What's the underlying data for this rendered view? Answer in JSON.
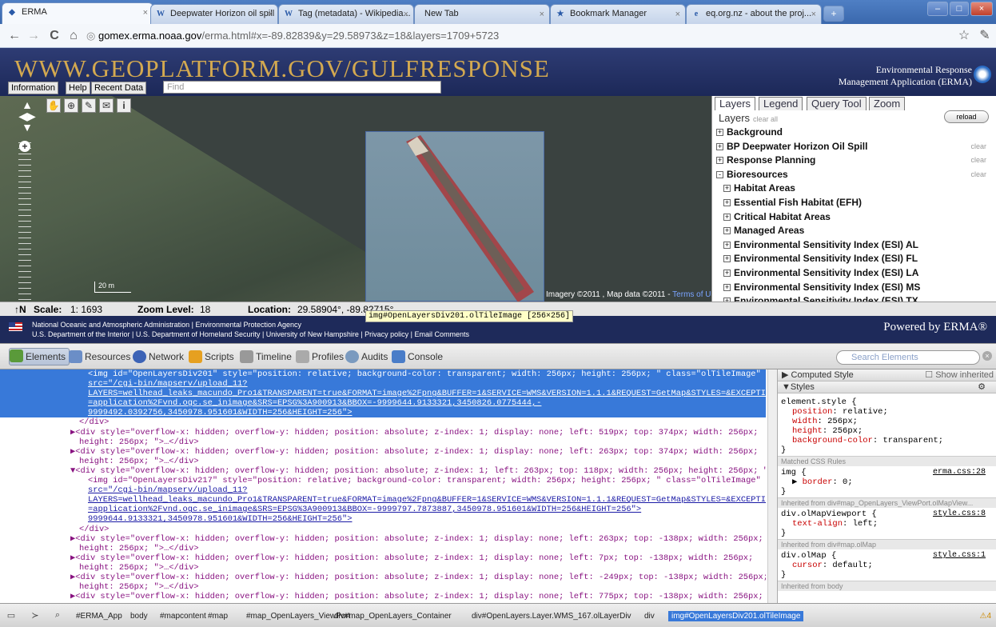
{
  "browser": {
    "tabs": [
      {
        "label": "ERMA",
        "fav": "e"
      },
      {
        "label": "Deepwater Horizon oil spill ...",
        "fav": "W"
      },
      {
        "label": "Tag (metadata) - Wikipedia...",
        "fav": "W"
      },
      {
        "label": "New Tab",
        "fav": ""
      },
      {
        "label": "Bookmark Manager",
        "fav": "★"
      },
      {
        "label": "eq.org.nz - about the proj...",
        "fav": "e"
      }
    ],
    "url_host": "gomex.erma.noaa.gov",
    "url_rest": "/erma.html#x=-89.82839&y=29.58973&z=18&layers=1709+5723"
  },
  "header": {
    "title": "WWW.GEOPLATFORM.GOV/GULFRESPONSE",
    "erma_line1": "Environmental Response",
    "erma_line2": "Management Application (ERMA)",
    "btn_information": "Information",
    "btn_help": "Help",
    "btn_recent": "Recent Data",
    "find_placeholder": "Find"
  },
  "map": {
    "scale_label": "20 m",
    "attribution": "Imagery ©2011 , Map data ©2011 - ",
    "terms": "Terms of Use"
  },
  "panel": {
    "tabs": [
      "Layers",
      "Legend",
      "Query Tool",
      "Zoom"
    ],
    "reload": "reload",
    "layers_title": "Layers",
    "clear_all": "clear all",
    "clear": "clear",
    "rows": [
      {
        "sym": "+",
        "label": "Background",
        "clear": false,
        "sub": false
      },
      {
        "sym": "+",
        "label": "BP Deepwater Horizon Oil Spill",
        "clear": true,
        "sub": false
      },
      {
        "sym": "+",
        "label": "Response Planning",
        "clear": true,
        "sub": false
      },
      {
        "sym": "-",
        "label": "Bioresources",
        "clear": true,
        "sub": false
      },
      {
        "sym": "+",
        "label": "Habitat Areas",
        "clear": false,
        "sub": true
      },
      {
        "sym": "+",
        "label": "Essential Fish Habitat (EFH)",
        "clear": false,
        "sub": true
      },
      {
        "sym": "+",
        "label": "Critical Habitat Areas",
        "clear": false,
        "sub": true
      },
      {
        "sym": "+",
        "label": "Managed Areas",
        "clear": false,
        "sub": true
      },
      {
        "sym": "+",
        "label": "Environmental Sensitivity Index (ESI) AL",
        "clear": false,
        "sub": true
      },
      {
        "sym": "+",
        "label": "Environmental Sensitivity Index (ESI) FL",
        "clear": false,
        "sub": true
      },
      {
        "sym": "+",
        "label": "Environmental Sensitivity Index (ESI) LA",
        "clear": false,
        "sub": true
      },
      {
        "sym": "+",
        "label": "Environmental Sensitivity Index (ESI) MS",
        "clear": false,
        "sub": true
      },
      {
        "sym": "+",
        "label": "Environmental Sensitivity Index (ESI) TX",
        "clear": false,
        "sub": true
      }
    ]
  },
  "status": {
    "north": "↑N",
    "scale_label": "Scale:",
    "scale_value": "1: 1693",
    "zoom_label": "Zoom Level:",
    "zoom_value": "18",
    "location_label": "Location:",
    "location_value": "29.58904°, -89.82715°",
    "tooltip": "img#OpenLayersDiv201.olTileImage [256×256]"
  },
  "footer": {
    "line1": "National Oceanic and Atmospheric Administration | Environmental Protection Agency",
    "line2": "U.S. Department of the Interior | U.S. Department of Homeland Security | University of New Hampshire | Privacy policy | Email Comments",
    "powered": "Powered by ERMA®"
  },
  "devtools": {
    "tabs": [
      "Elements",
      "Resources",
      "Network",
      "Scripts",
      "Timeline",
      "Profiles",
      "Audits",
      "Console"
    ],
    "search_placeholder": "Search Elements",
    "dom_lines": [
      {
        "t": "<img id=\"OpenLayersDiv201\" style=\"position: relative; background-color: transparent; width: 256px; height: 256px; \" class=\"olTileImage\"",
        "sel": true,
        "ind": 2
      },
      {
        "t": "src=\"/cgi-bin/mapserv/upload_11?",
        "sel": true,
        "ind": 2,
        "link": true
      },
      {
        "t": "LAYERS=wellhead_leaks_macundo_Pro1&TRANSPARENT=true&FORMAT=image%2Fpng&BUFFER=1&SERVICE=WMS&VERSION=1.1.1&REQUEST=GetMap&STYLES=&EXCEPTIONS",
        "sel": true,
        "ind": 2,
        "link": true
      },
      {
        "t": "=application%2Fvnd.ogc.se_inimage&SRS=EPSG%3A900913&BBOX=-9999644.9133321,3450826.0775444,-",
        "sel": true,
        "ind": 2,
        "link": true
      },
      {
        "t": "9999492.0392756,3450978.951601&WIDTH=256&HEIGHT=256\">",
        "sel": true,
        "ind": 2,
        "link": true
      },
      {
        "t": "</div>",
        "sel": false,
        "ind": 1
      },
      {
        "t": "▶<div style=\"overflow-x: hidden; overflow-y: hidden; position: absolute; z-index: 1; display: none; left: 519px; top: 374px; width: 256px;",
        "sel": false,
        "ind": 0
      },
      {
        "t": "height: 256px; \">…</div>",
        "sel": false,
        "ind": 1
      },
      {
        "t": "▶<div style=\"overflow-x: hidden; overflow-y: hidden; position: absolute; z-index: 1; display: none; left: 263px; top: 374px; width: 256px;",
        "sel": false,
        "ind": 0
      },
      {
        "t": "height: 256px; \">…</div>",
        "sel": false,
        "ind": 1
      },
      {
        "t": "▼<div style=\"overflow-x: hidden; overflow-y: hidden; position: absolute; z-index: 1; left: 263px; top: 118px; width: 256px; height: 256px; \">",
        "sel": false,
        "ind": 0
      },
      {
        "t": "<img id=\"OpenLayersDiv217\" style=\"position: relative; background-color: transparent; width: 256px; height: 256px; \" class=\"olTileImage\"",
        "sel": false,
        "ind": 2
      },
      {
        "t": "src=\"/cgi-bin/mapserv/upload_11?",
        "sel": false,
        "ind": 2,
        "link": true
      },
      {
        "t": "LAYERS=wellhead_leaks_macundo_Pro1&TRANSPARENT=true&FORMAT=image%2Fpng&BUFFER=1&SERVICE=WMS&VERSION=1.1.1&REQUEST=GetMap&STYLES=&EXCEPTIONS",
        "sel": false,
        "ind": 2,
        "link": true
      },
      {
        "t": "=application%2Fvnd.ogc.se_inimage&SRS=EPSG%3A900913&BBOX=-9999797.7873887,3450978.951601&WIDTH=256&HEIGHT=256\">",
        "sel": false,
        "ind": 2,
        "link": true
      },
      {
        "t": "9999644.9133321,3450978.951601&WIDTH=256&HEIGHT=256\">",
        "sel": false,
        "ind": 2,
        "link": true
      },
      {
        "t": "</div>",
        "sel": false,
        "ind": 1
      },
      {
        "t": "▶<div style=\"overflow-x: hidden; overflow-y: hidden; position: absolute; z-index: 1; display: none; left: 263px; top: -138px; width: 256px;",
        "sel": false,
        "ind": 0
      },
      {
        "t": "height: 256px; \">…</div>",
        "sel": false,
        "ind": 1
      },
      {
        "t": "▶<div style=\"overflow-x: hidden; overflow-y: hidden; position: absolute; z-index: 1; display: none; left: 7px; top: -138px; width: 256px;",
        "sel": false,
        "ind": 0
      },
      {
        "t": "height: 256px; \">…</div>",
        "sel": false,
        "ind": 1
      },
      {
        "t": "▶<div style=\"overflow-x: hidden; overflow-y: hidden; position: absolute; z-index: 1; display: none; left: -249px; top: -138px; width: 256px;",
        "sel": false,
        "ind": 0
      },
      {
        "t": "height: 256px; \">…</div>",
        "sel": false,
        "ind": 1
      },
      {
        "t": "▶<div style=\"overflow-x: hidden; overflow-y: hidden; position: absolute; z-index: 1; display: none; left: 775px; top: -138px; width: 256px;",
        "sel": false,
        "ind": 0
      }
    ],
    "styles": {
      "computed": "Computed Style",
      "show_inherited": "Show inherited",
      "styles_hdr": "Styles",
      "element_style": "element.style {",
      "es_props": [
        {
          "n": "position",
          "v": "relative;"
        },
        {
          "n": "width",
          "v": "256px;"
        },
        {
          "n": "height",
          "v": "256px;"
        },
        {
          "n": "background-color",
          "v": "transparent;"
        }
      ],
      "close": "}",
      "matched": "Matched CSS Rules",
      "img_rule": "img {",
      "img_src": "erma.css:28",
      "img_prop_n": "border",
      "img_prop_v": "0;",
      "inh1": "Inherited from div#map_OpenLayers_ViewPort.olMapView...",
      "vp_rule": "div.olMapViewport {",
      "vp_src": "style.css:8",
      "vp_prop_n": "text-align",
      "vp_prop_v": "left;",
      "inh2": "Inherited from div#map.olMap",
      "map_rule": "div.olMap {",
      "map_src": "style.css:1",
      "map_prop_n": "cursor",
      "map_prop_v": "default;",
      "inh3": "Inherited from body"
    },
    "breadcrumbs": [
      "#ERMA_App",
      "body",
      "#mapcontent",
      "#map",
      "#map_OpenLayers_ViewPort",
      "div#map_OpenLayers_Container",
      "div#OpenLayers.Layer.WMS_167.olLayerDiv",
      "div",
      "img#OpenLayersDiv201.olTileImage"
    ],
    "warnings": "4"
  }
}
